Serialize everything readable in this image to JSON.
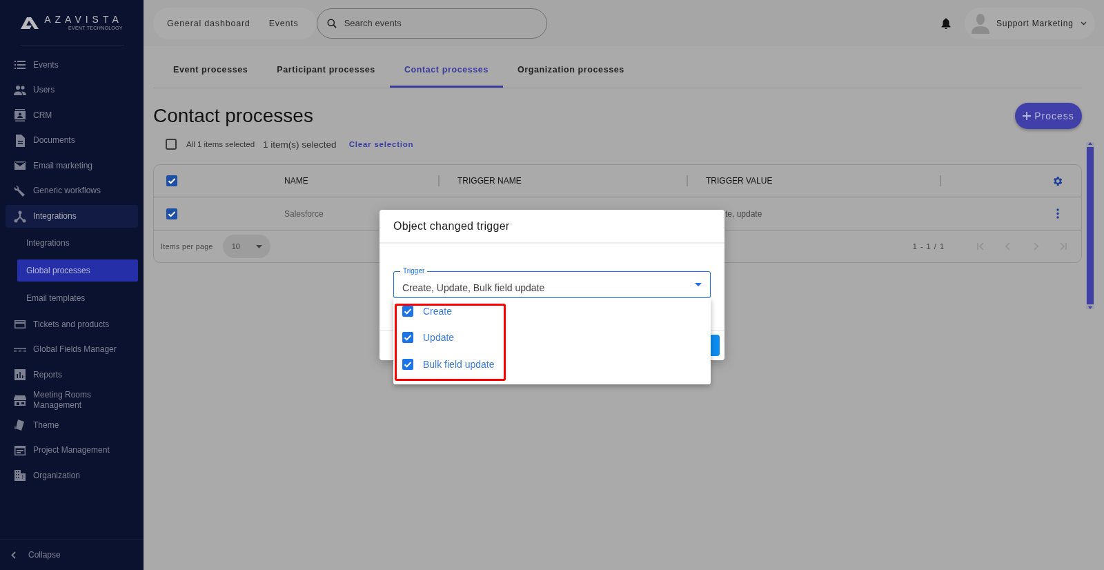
{
  "logo": {
    "name": "AZAVISTA",
    "tagline": "EVENT TECHNOLOGY"
  },
  "sidebar": {
    "items": [
      {
        "label": "Events",
        "active": false
      },
      {
        "label": "Users",
        "active": false
      },
      {
        "label": "CRM",
        "active": false
      },
      {
        "label": "Documents",
        "active": false
      },
      {
        "label": "Email marketing",
        "active": false
      },
      {
        "label": "Generic workflows",
        "active": false
      },
      {
        "label": "Integrations",
        "active": true,
        "children": [
          {
            "label": "Integrations",
            "selected": false
          },
          {
            "label": "Global processes",
            "selected": true
          },
          {
            "label": "Email templates",
            "selected": false
          }
        ]
      },
      {
        "label": "Tickets and products",
        "active": false
      },
      {
        "label": "Global Fields Manager",
        "active": false
      },
      {
        "label": "Reports",
        "active": false
      },
      {
        "label": "Meeting Rooms Management",
        "active": false
      },
      {
        "label": "Theme",
        "active": false
      },
      {
        "label": "Project Management",
        "active": false
      },
      {
        "label": "Organization",
        "active": false
      }
    ],
    "collapse": "Collapse"
  },
  "top_nav": {
    "links": [
      "General dashboard",
      "Events"
    ],
    "search": {
      "placeholder": "Search events"
    },
    "user": {
      "name": "Support Marketing"
    }
  },
  "tabs": [
    {
      "label": "Event processes",
      "selected": false
    },
    {
      "label": "Participant processes",
      "selected": false
    },
    {
      "label": "Contact processes",
      "selected": true
    },
    {
      "label": "Organization processes",
      "selected": false
    }
  ],
  "page": {
    "title": "Contact processes",
    "add_button": "Process",
    "selection": {
      "all_checked": false,
      "all_label": "All 1 items selected",
      "count": "1 item(s) selected",
      "clear": "Clear selection"
    }
  },
  "table": {
    "header_checked": true,
    "columns": [
      "NAME",
      "TRIGGER NAME",
      "TRIGGER VALUE"
    ],
    "rows": [
      {
        "checked": true,
        "name": "Salesforce",
        "trigger_value": "te, update"
      }
    ],
    "footer": {
      "items_per_page": "Items per page",
      "page_size": "10",
      "range": "1 - 1 / 1"
    }
  },
  "dialog": {
    "title": "Object changed trigger",
    "field": {
      "label": "Trigger",
      "value": "Create, Update, Bulk field update"
    },
    "options": [
      {
        "label": "Create",
        "checked": true
      },
      {
        "label": "Update",
        "checked": true
      },
      {
        "label": "Bulk field update",
        "checked": true
      }
    ]
  }
}
